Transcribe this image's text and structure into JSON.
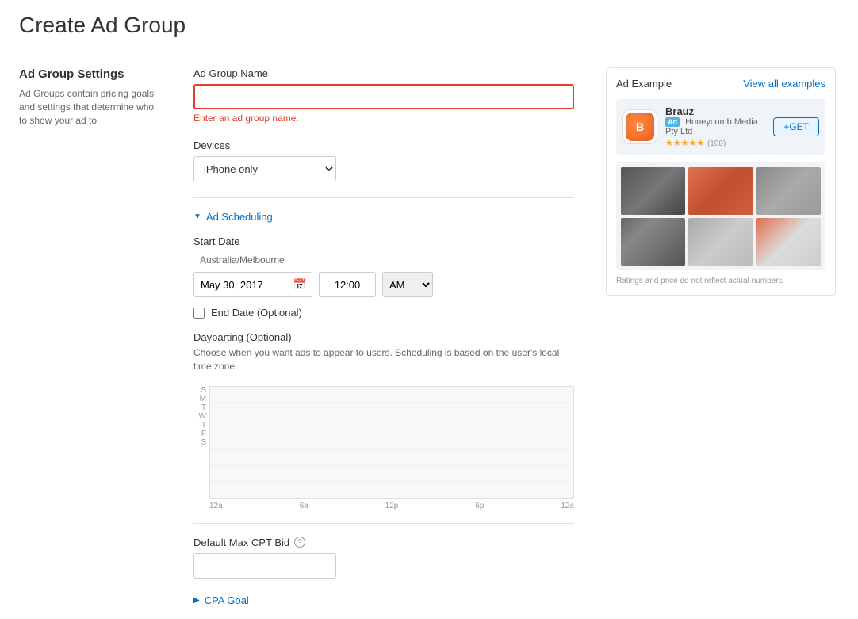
{
  "page": {
    "title": "Create Ad Group"
  },
  "sidebar": {
    "title": "Ad Group Settings",
    "description": "Ad Groups contain pricing goals and settings that determine who to show your ad to."
  },
  "form": {
    "adGroupName": {
      "label": "Ad Group Name",
      "value": "",
      "placeholder": "",
      "error": "Enter an ad group name."
    },
    "devices": {
      "label": "Devices",
      "value": "iPhone only"
    },
    "adScheduling": {
      "label": "Ad Scheduling"
    },
    "startDate": {
      "label": "Start Date",
      "value": "May 30, 2017",
      "timezone": "Australia/Melbourne"
    },
    "time": {
      "value": "12:00",
      "ampm": "AM"
    },
    "endDate": {
      "label": "End Date (Optional)",
      "checked": false
    },
    "dayparting": {
      "title": "Dayparting (Optional)",
      "description": "Choose when you want ads to appear to users. Scheduling is based on the user's local time zone."
    },
    "timeAxis": {
      "labels": [
        "12a",
        "6a",
        "12p",
        "6p",
        "12a"
      ]
    },
    "days": [
      {
        "label": "S"
      },
      {
        "label": "M"
      },
      {
        "label": "T"
      },
      {
        "label": "W"
      },
      {
        "label": "T"
      },
      {
        "label": "F"
      },
      {
        "label": "S"
      }
    ],
    "cptBid": {
      "label": "Default Max CPT Bid",
      "value": "",
      "helpTooltip": "?"
    },
    "cpaGoal": {
      "label": "CPA Goal"
    }
  },
  "adExample": {
    "title": "Ad Example",
    "viewAllLabel": "View all examples",
    "app": {
      "name": "Brauz",
      "adBadge": "Ad",
      "publisher": "Honeycomb Media Pty Ltd",
      "rating": "★★★★★",
      "ratingCount": "(100)",
      "getButton": "+GET"
    },
    "disclaimer": "Ratings and price do not reflect actual numbers."
  }
}
